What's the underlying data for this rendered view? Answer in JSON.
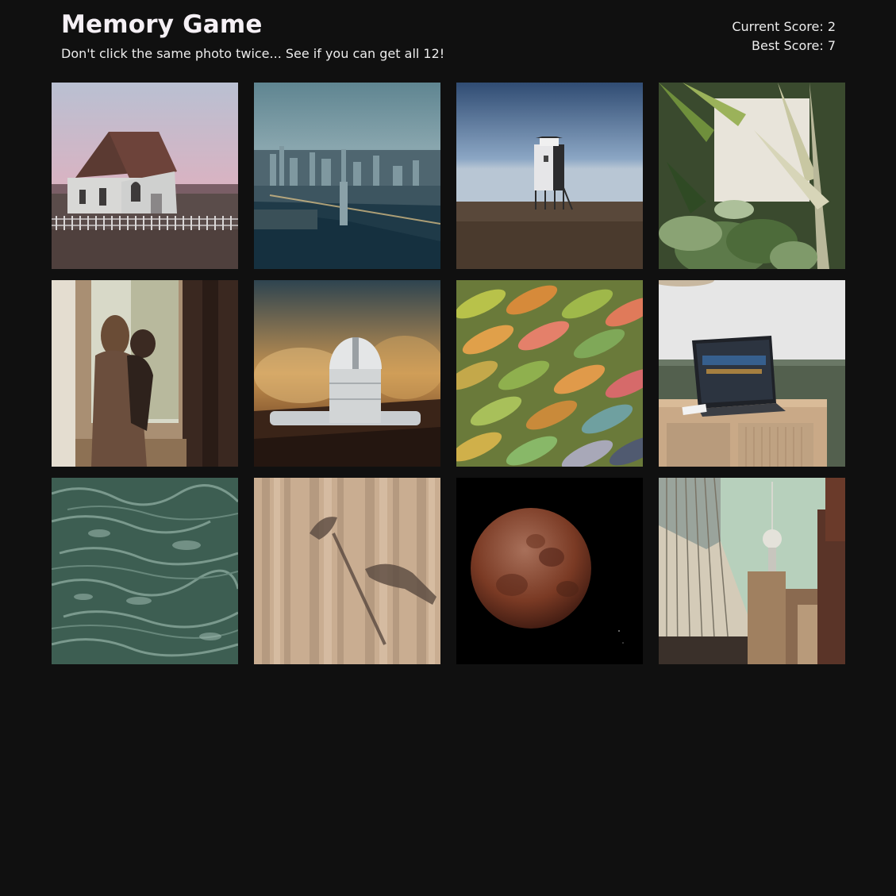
{
  "header": {
    "title": "Memory Game",
    "subtitle": "Don't click the same photo twice... See if you can get all 12!"
  },
  "scores": {
    "current_label": "Current Score:",
    "current_value": 2,
    "best_label": "Best Score:",
    "best_value": 7
  },
  "cards": [
    {
      "name": "card-white-church",
      "icon": "church-photo"
    },
    {
      "name": "card-city-river",
      "icon": "city-photo"
    },
    {
      "name": "card-lighthouse",
      "icon": "lighthouse-photo"
    },
    {
      "name": "card-tropical-plants",
      "icon": "plants-photo"
    },
    {
      "name": "card-mother-child",
      "icon": "mother-child-photo"
    },
    {
      "name": "card-observatory",
      "icon": "observatory-photo"
    },
    {
      "name": "card-feathers",
      "icon": "feathers-photo"
    },
    {
      "name": "card-laptop-desk",
      "icon": "laptop-photo"
    },
    {
      "name": "card-ocean-water",
      "icon": "ocean-photo"
    },
    {
      "name": "card-curtain-shadow",
      "icon": "curtain-photo"
    },
    {
      "name": "card-blood-moon",
      "icon": "moon-photo"
    },
    {
      "name": "card-tv-tower",
      "icon": "tv-tower-photo"
    }
  ],
  "colors": {
    "background": "#101010",
    "text": "#f2f2f2"
  }
}
